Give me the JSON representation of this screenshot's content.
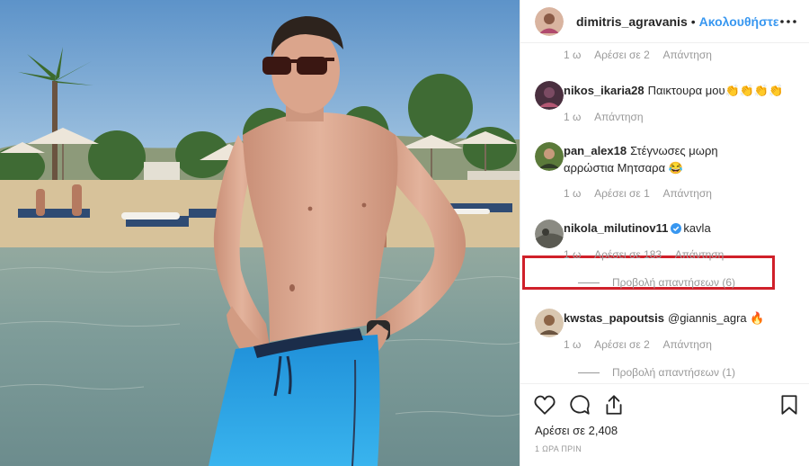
{
  "post": {
    "username": "dimitris_agravanis",
    "separator": "•",
    "follow_label": "Ακολουθήστε",
    "more_icon": "more-horizontal-icon"
  },
  "comments": {
    "partial": {
      "time": "1 ω",
      "likes": "Αρέσει σε 2",
      "reply": "Απάντηση"
    },
    "items": [
      {
        "username": "nikos_ikaria28",
        "text": "Παικτουρα μου👏👏👏👏",
        "time": "1 ω",
        "reply": "Απάντηση"
      },
      {
        "username": "pan_alex18",
        "text": "Στέγνωσες μωρη",
        "text2": "αρρώστια Μητσαρα 😂",
        "time": "1 ω",
        "likes": "Αρέσει σε 1",
        "reply": "Απάντηση"
      },
      {
        "username": "nikola_milutinov11",
        "text": "kavla",
        "verified": true,
        "time": "1 ω",
        "likes": "Αρέσει σε 183",
        "reply": "Απάντηση",
        "view_replies": "Προβολή απαντήσεων (6)"
      },
      {
        "username": "kwstas_papoutsis",
        "text": "@giannis_agra 🔥",
        "time": "1 ω",
        "likes": "Αρέσει σε 2",
        "reply": "Απάντηση",
        "view_replies": "Προβολή απαντήσεων (1)"
      }
    ]
  },
  "footer": {
    "likes": "Αρέσει σε 2,408",
    "posted": "1 ΩΡΑ ΠΡΙΝ",
    "icons": [
      "heart-icon",
      "comment-icon",
      "share-icon",
      "bookmark-icon"
    ]
  },
  "colors": {
    "accent": "#3897f0",
    "highlight": "#d0202a",
    "verified": "#3897f0",
    "muted": "#999999"
  }
}
